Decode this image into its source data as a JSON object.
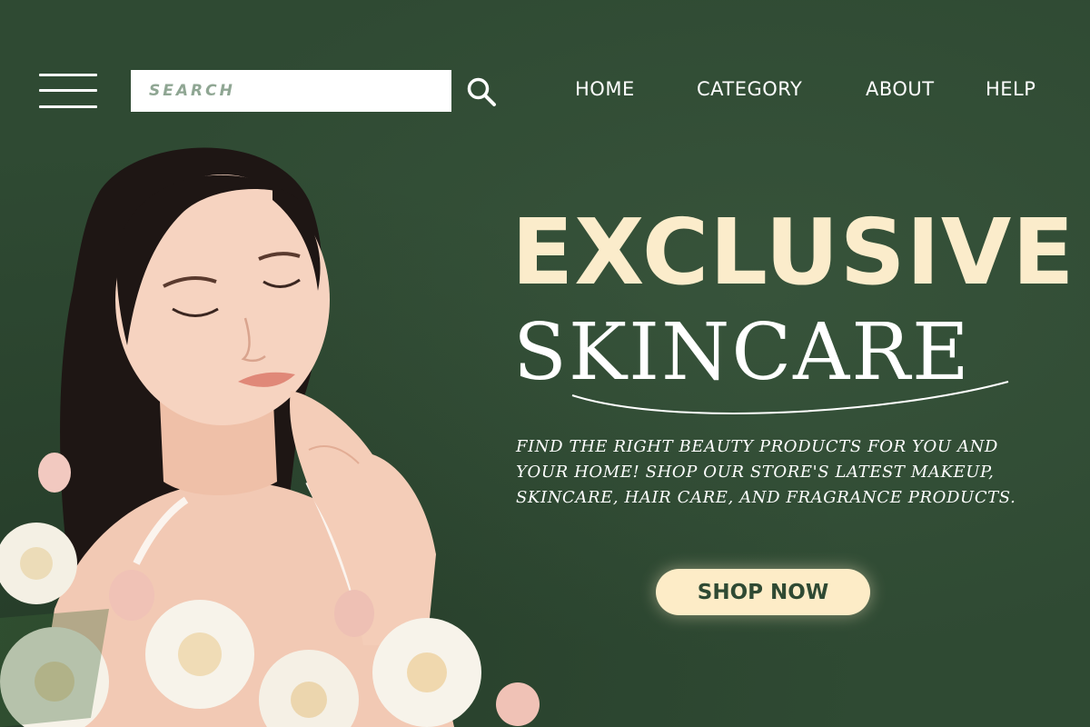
{
  "header": {
    "menu_icon": "hamburger-menu-icon",
    "search": {
      "placeholder": "SEARCH",
      "value": ""
    },
    "search_icon": "magnifier-search-icon",
    "nav": [
      {
        "label": "HOME"
      },
      {
        "label": "CATEGORY"
      },
      {
        "label": "ABOUT"
      },
      {
        "label": "HELP"
      }
    ]
  },
  "hero": {
    "title": "EXCLUSIVE",
    "subtitle": "SKINCARE",
    "description": "FIND THE RIGHT BEAUTY PRODUCTS FOR YOU AND YOUR HOME! SHOP OUR STORE'S LATEST MAKEUP, SKINCARE, HAIR CARE, AND FRAGRANCE PRODUCTS.",
    "cta_label": "SHOP NOW"
  },
  "colors": {
    "background": "#2f4a33",
    "title_cream": "#fbeccb",
    "button_bg": "#fdecc7",
    "button_text": "#2f4a33",
    "text_white": "#ffffff"
  }
}
